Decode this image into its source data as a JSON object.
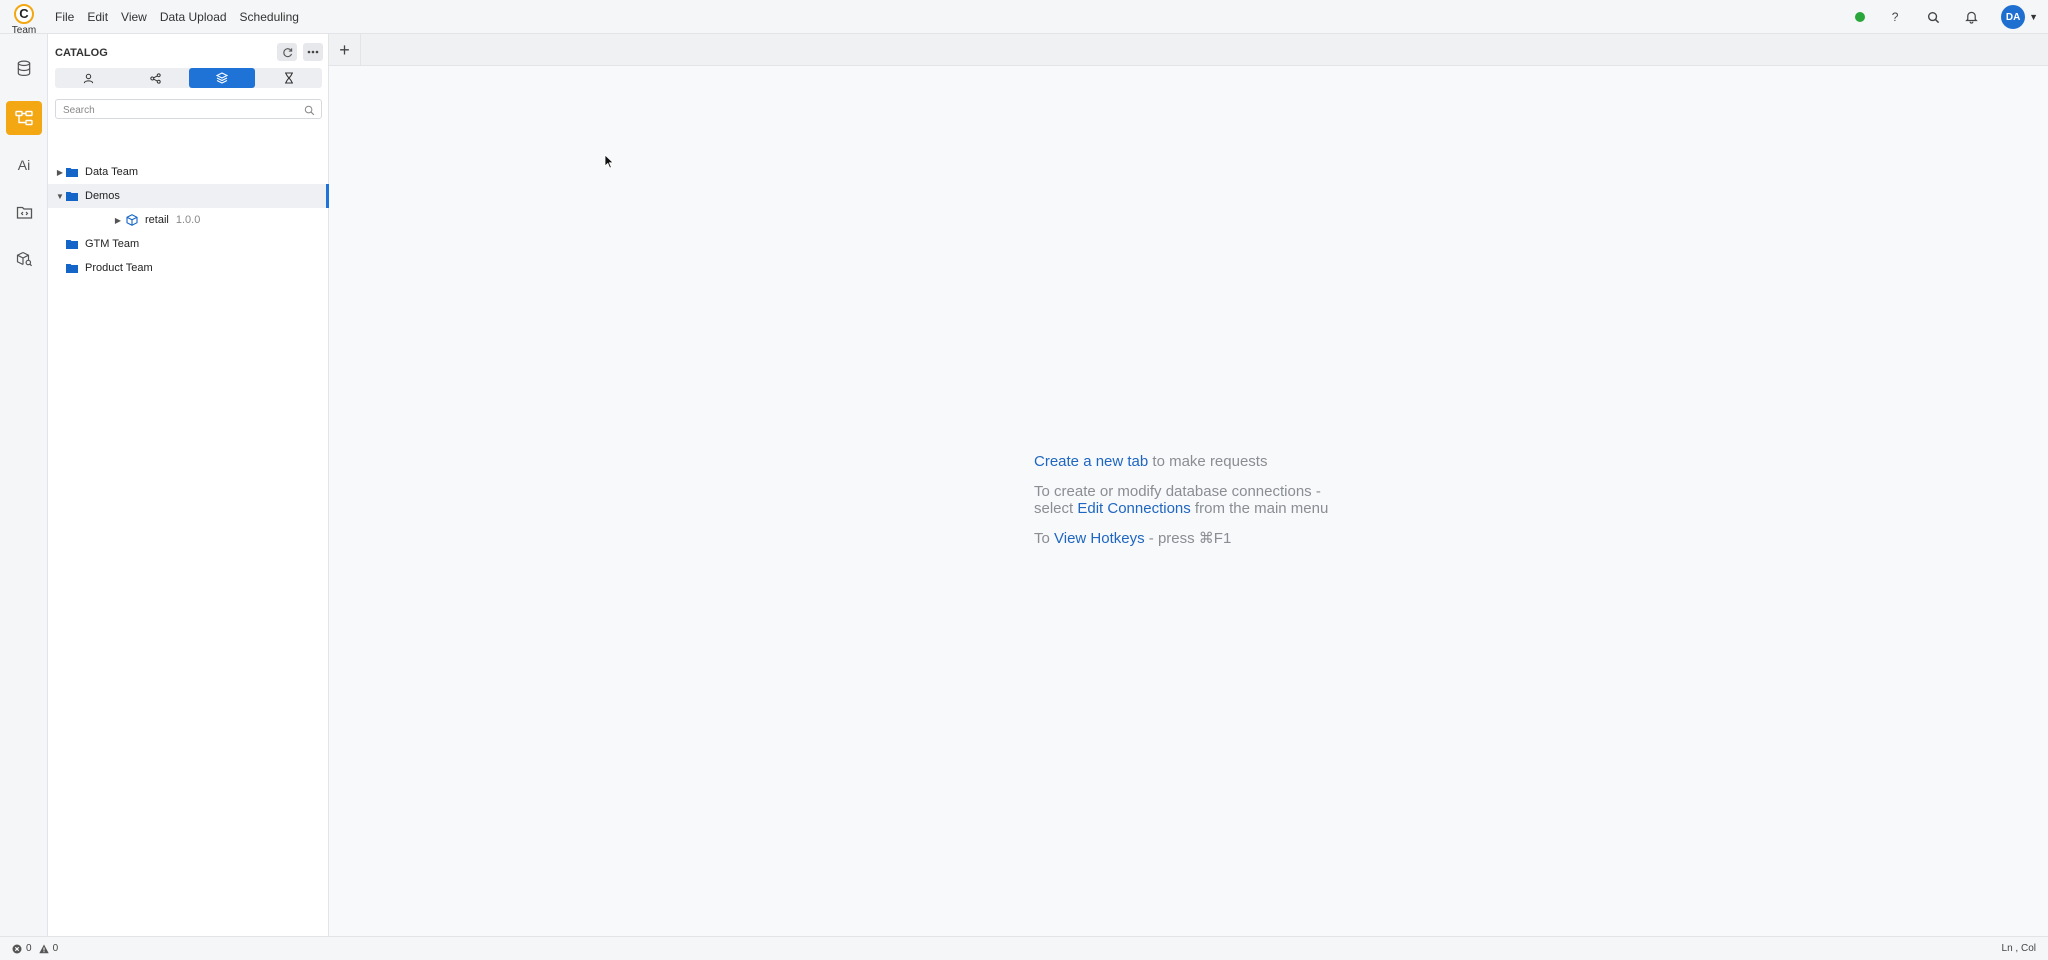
{
  "app": {
    "logo_letter": "C",
    "logo_label": "Team",
    "brand_color": "#f3a712"
  },
  "menu": [
    "File",
    "Edit",
    "View",
    "Data Upload",
    "Scheduling"
  ],
  "topbar": {
    "status_color": "#2aa63a",
    "help_label": "?",
    "avatar_initials": "DA",
    "avatar_color": "#1f6fd1"
  },
  "rail": {
    "items": [
      "database-icon",
      "lineage-icon",
      "ai-icon",
      "code-folder-icon",
      "package-search-icon"
    ],
    "ai_label": "Ai",
    "active_index": 1,
    "active_color": "#f3a712"
  },
  "catalog": {
    "title": "CATALOG",
    "segments": [
      "user-icon",
      "share-icon",
      "layers-icon",
      "hourglass-icon"
    ],
    "active_segment": 2,
    "accent": "#1f72d6",
    "search_placeholder": "Search",
    "tree": [
      {
        "label": "Data Team",
        "expanded": false,
        "level": 0,
        "type": "folder"
      },
      {
        "label": "Demos",
        "expanded": true,
        "level": 0,
        "type": "folder",
        "selected": true
      },
      {
        "label": "retail",
        "version": "1.0.0",
        "level": 1,
        "type": "package"
      },
      {
        "label": "GTM Team",
        "level": 0,
        "type": "folder"
      },
      {
        "label": "Product Team",
        "level": 0,
        "type": "folder"
      }
    ]
  },
  "tabs": {
    "add_label": "+"
  },
  "empty_state": {
    "line1_link": "Create a new tab",
    "line1_rest": " to make requests",
    "line2_a": "To create or modify database connections -",
    "line2_b_pre": "select ",
    "line2_b_link": "Edit Connections",
    "line2_b_rest": " from the main menu",
    "line3_pre": "To ",
    "line3_link": "View Hotkeys",
    "line3_rest": " - press ⌘F1"
  },
  "statusbar": {
    "errors": "0",
    "warnings": "0",
    "position": "Ln , Col"
  }
}
